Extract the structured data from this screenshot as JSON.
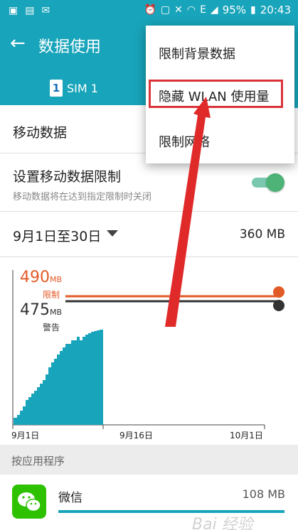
{
  "status_bar": {
    "battery": "95%",
    "time": "20:43",
    "network_letter": "E"
  },
  "app_bar": {
    "back_icon": "arrow-left-icon",
    "title": "数据使用"
  },
  "sim_tab": {
    "number": "1",
    "label": "SIM 1"
  },
  "mobile_data": {
    "label": "移动数据"
  },
  "limit": {
    "title": "设置移动数据限制",
    "subtitle": "移动数据将在达到指定限制时关闭",
    "enabled": true
  },
  "period": {
    "label": "9月1日至30日",
    "amount": "360 MB"
  },
  "chart_data": {
    "type": "area",
    "limit": {
      "value": 490,
      "unit": "MB",
      "label": "限制",
      "color": "#e25a27"
    },
    "warning": {
      "value": 475,
      "unit": "MB",
      "label": "警告",
      "color": "#333333"
    },
    "x_ticks": [
      "9月1日",
      "9月16日",
      "10月1日"
    ],
    "usage_color": "#18a4ba"
  },
  "section": {
    "label": "按应用程序"
  },
  "apps": [
    {
      "name": "微信",
      "amount": "108 MB"
    }
  ],
  "menu": {
    "items": [
      "限制背景数据",
      "隐藏 WLAN 使用量",
      "限制网络"
    ]
  },
  "watermark": "Bai 经验"
}
